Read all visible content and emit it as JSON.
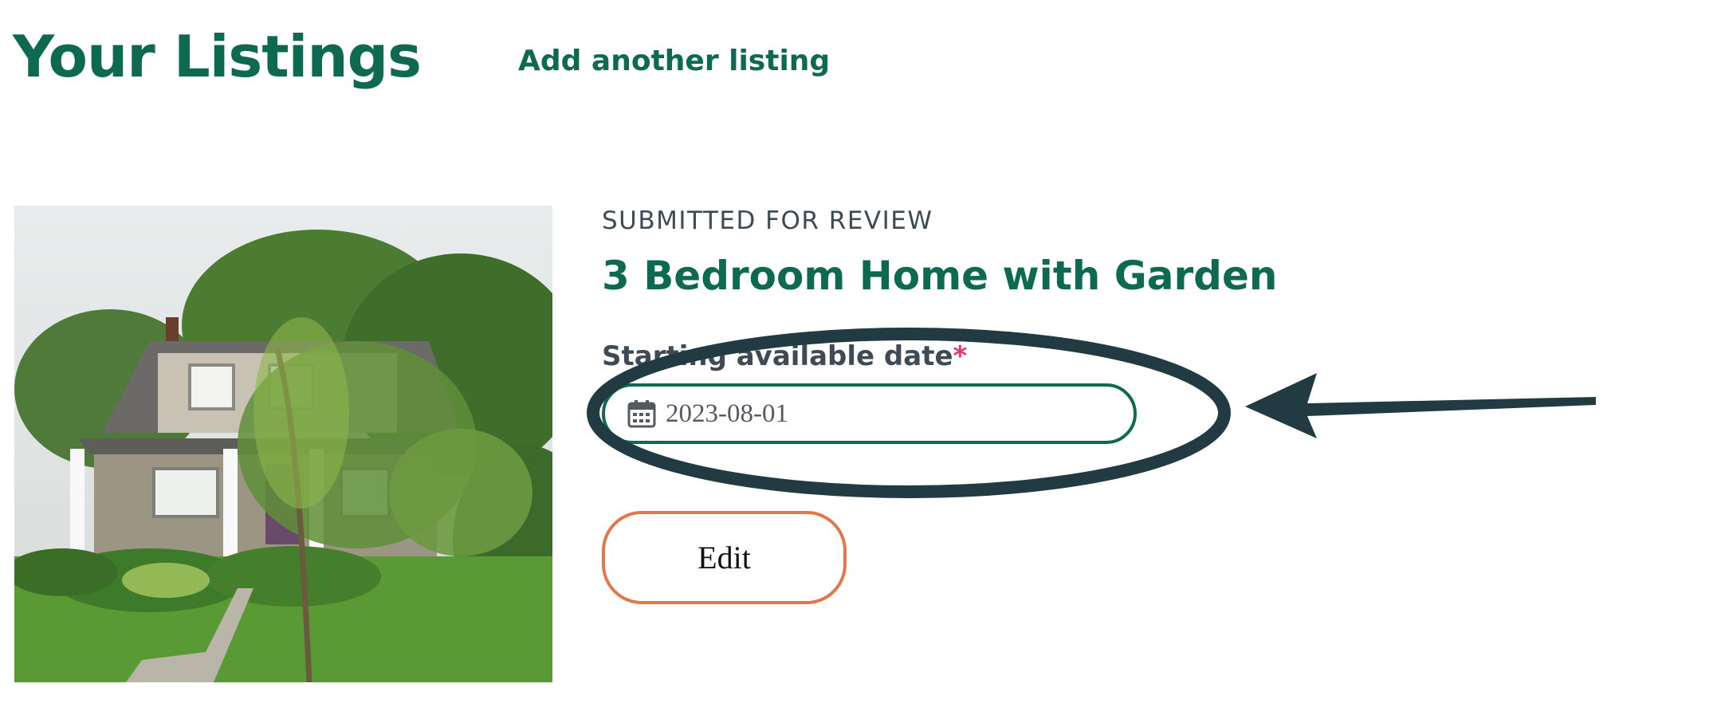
{
  "header": {
    "title": "Your Listings",
    "add_link": "Add another listing"
  },
  "listing": {
    "status": "SUBMITTED FOR REVIEW",
    "title": "3 Bedroom Home with Garden",
    "date_label": "Starting available date",
    "required_mark": "*",
    "date_value": "2023-08-01",
    "edit_label": "Edit"
  },
  "colors": {
    "brand_green": "#0d6a50",
    "status_text": "#3e4a55",
    "required": "#e8336b",
    "edit_border": "#e2774b",
    "annotation": "#223a42"
  },
  "icons": {
    "date_field": "calendar-icon",
    "annotation": "arrow-icon"
  }
}
